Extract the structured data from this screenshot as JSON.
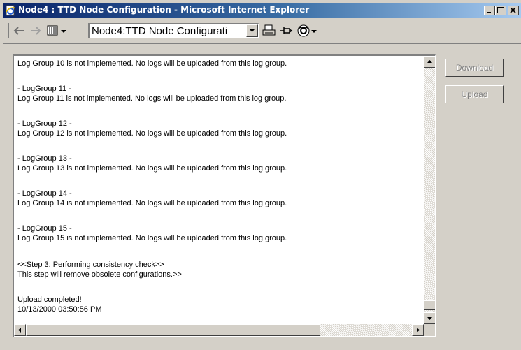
{
  "window": {
    "title": "Node4 : TTD Node Configuration - Microsoft Internet Explorer"
  },
  "toolbar": {
    "address_value": "Node4:TTD Node Configurati"
  },
  "icons": {
    "app": "ie-page-icon",
    "back": "back-arrow-icon",
    "forward": "forward-arrow-icon",
    "view": "view-columns-icon",
    "print": "print-icon",
    "pin": "pin-icon",
    "watch": "eye-icon"
  },
  "log": {
    "lines": [
      "Log Group 10 is not implemented. No logs will be uploaded from this log group.",
      "- LogGroup 11 -",
      "Log Group 11 is not implemented. No logs will be uploaded from this log group.",
      "- LogGroup 12 -",
      "Log Group 12 is not implemented. No logs will be uploaded from this log group.",
      "- LogGroup 13 -",
      "Log Group 13 is not implemented. No logs will be uploaded from this log group.",
      "- LogGroup 14 -",
      "Log Group 14 is not implemented. No logs will be uploaded from this log group.",
      "- LogGroup 15 -",
      "Log Group 15 is not implemented. No logs will be uploaded from this log group.",
      "<<Step 3: Performing consistency check>>",
      "This step will remove obsolete configurations.>>",
      "Upload completed!",
      "10/13/2000 03:50:56 PM"
    ]
  },
  "buttons": {
    "download": "Download",
    "upload": "Upload"
  }
}
